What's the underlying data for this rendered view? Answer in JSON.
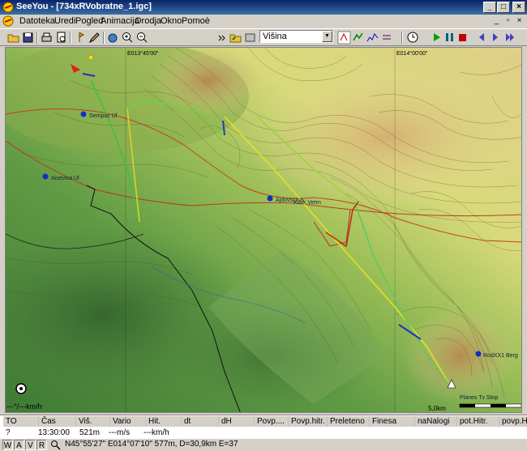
{
  "window": {
    "title": "SeeYou - [734xRVobratne_1.igc]"
  },
  "menu": [
    "Datoteka",
    "Uredi",
    "Pogled",
    "Animacija",
    "Orodja",
    "Okno",
    "Pomoè"
  ],
  "toolbar": {
    "combo_value": "Višina"
  },
  "map": {
    "coords": {
      "left": "E013°45'00\"",
      "right": "E014°00'00\""
    },
    "places": [
      {
        "label": "Sempas Ul"
      },
      {
        "label": "Aisevica Ul"
      },
      {
        "label": "Ajdovscina"
      },
      {
        "label": "Kovk Vetrn"
      },
      {
        "label": "Planes Tv Stop"
      },
      {
        "label": "RodXX1 Berg"
      }
    ],
    "speed_label": "---°/---km/h",
    "scale_label": "5,0km"
  },
  "table": {
    "headers": [
      "TO",
      "Čas",
      "Viš.",
      "Vario",
      "Hit.",
      "dt",
      "dH",
      "Povp....",
      "Povp.hitr.",
      "Preleteno",
      "Finesa",
      "naNalogi",
      "pot.Hitr.",
      "povp.Hi"
    ],
    "row": [
      "?",
      "13:30:00",
      "521m",
      "---m/s",
      "---km/h",
      "",
      "",
      "",
      "",
      "",
      "",
      "",
      "",
      ""
    ]
  },
  "status": {
    "buttons": [
      "W",
      "A",
      "V",
      "R"
    ],
    "text": "N45°55'27\"  E014°07'10\" 577m, D=30,9km E=37"
  },
  "colors": {
    "title_bar": "#0a246a",
    "flight_track_red": "#cc2020",
    "flight_track_yellow": "#e8e020",
    "flight_track_green": "#40c040"
  }
}
